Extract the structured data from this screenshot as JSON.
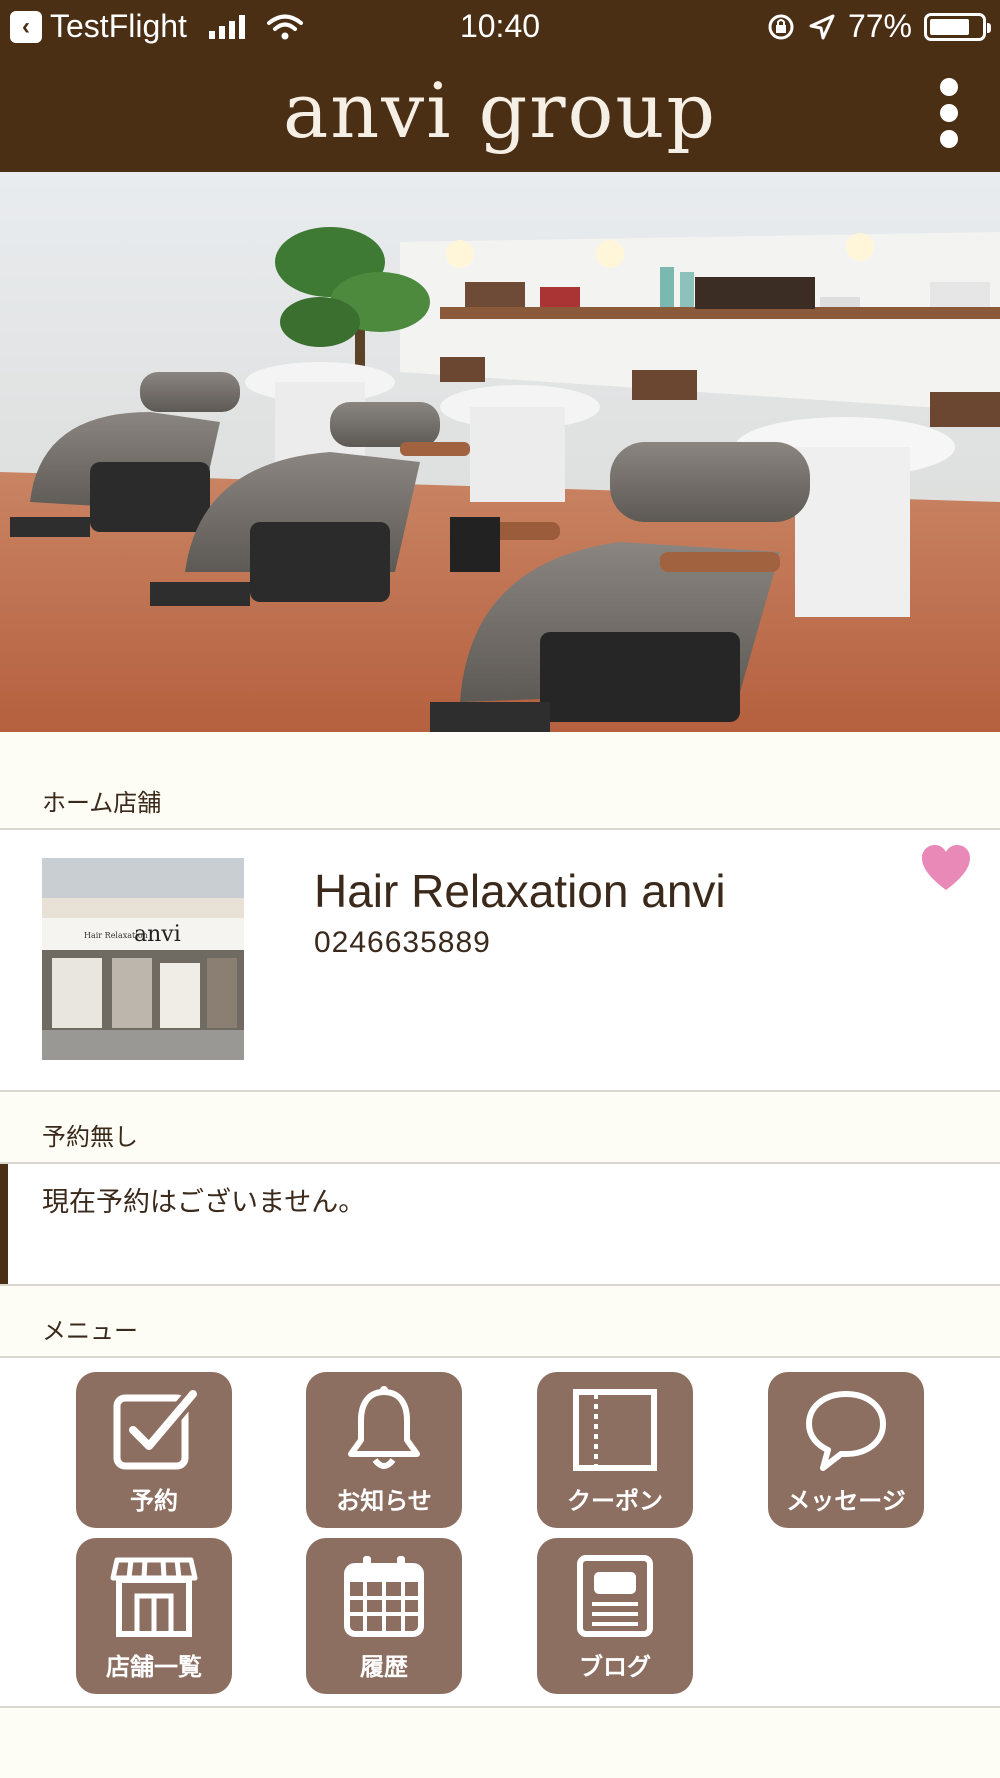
{
  "status_bar": {
    "back_app": "TestFlight",
    "time": "10:40",
    "battery": "77%",
    "battery_level": 0.77
  },
  "header": {
    "title": "anvi group",
    "menu_icon": "kebab-menu-icon"
  },
  "home_store": {
    "section_label": "ホーム店舗",
    "name": "Hair Relaxation anvi",
    "phone": "0246635889",
    "favorite_icon": "heart-icon",
    "favorite_color": "#e889b8",
    "storefront_sign": "anvi",
    "storefront_sign_small": "Hair Relaxation"
  },
  "reservation": {
    "section_label": "予約無し",
    "message": "現在予約はございません。"
  },
  "menu": {
    "section_label": "メニュー",
    "button_color": "#8d6f62",
    "items": [
      {
        "label": "予約",
        "icon": "checkbox-icon"
      },
      {
        "label": "お知らせ",
        "icon": "bell-icon"
      },
      {
        "label": "クーポン",
        "icon": "coupon-icon"
      },
      {
        "label": "メッセージ",
        "icon": "speech-bubble-icon"
      },
      {
        "label": "店舗一覧",
        "icon": "storefront-icon"
      },
      {
        "label": "履歴",
        "icon": "calendar-icon"
      },
      {
        "label": "ブログ",
        "icon": "document-icon"
      }
    ]
  },
  "colors": {
    "header_bg": "#4a2f14",
    "page_bg": "#fdfdf5",
    "text": "#3b2a1c"
  }
}
